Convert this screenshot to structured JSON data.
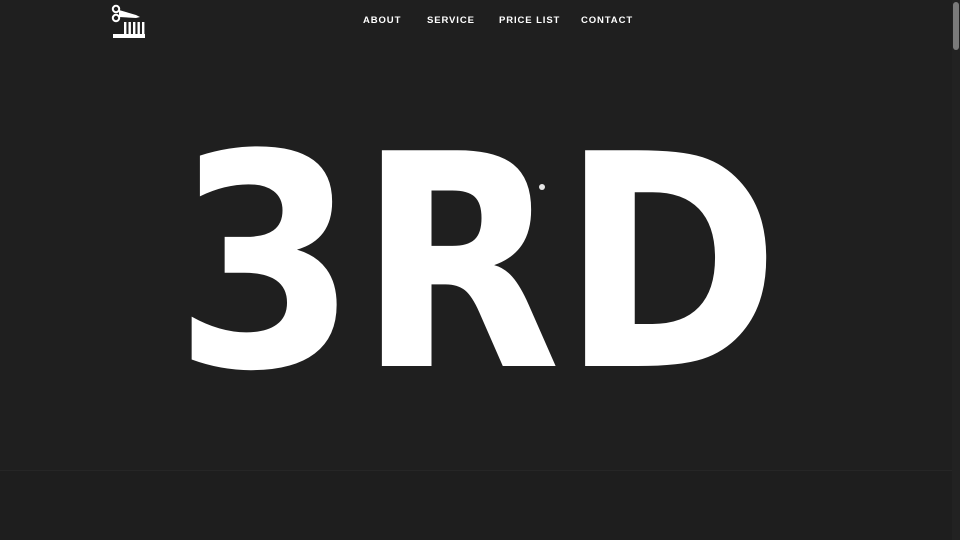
{
  "logo": {
    "icon": "scissors-comb-icon",
    "color": "#ffffff"
  },
  "nav": {
    "items": [
      {
        "label": "ABOUT"
      },
      {
        "label": "SERVICE"
      },
      {
        "label": "PRICE LIST"
      },
      {
        "label": "CONTACT"
      }
    ]
  },
  "hero": {
    "title": "3RD",
    "text_color": "#ffffff"
  },
  "theme": {
    "background": "#1f1f1f",
    "foreground": "#ffffff"
  }
}
